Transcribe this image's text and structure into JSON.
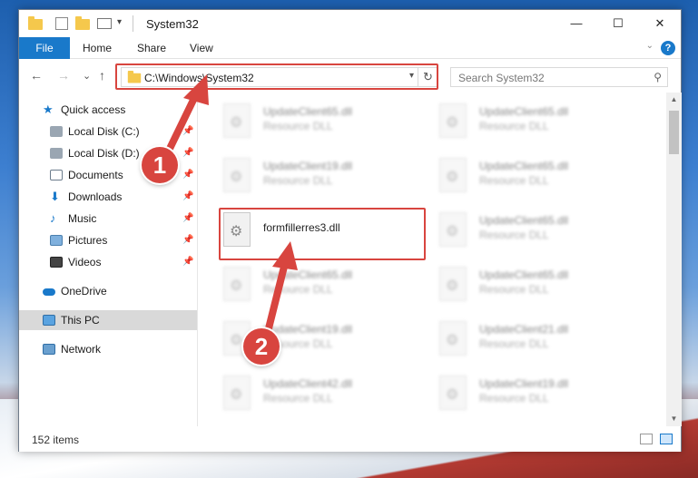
{
  "window": {
    "title": "System32",
    "tabs": [
      "File",
      "Home",
      "Share",
      "View"
    ],
    "controls": {
      "minimize": "—",
      "maximize": "☐",
      "close": "✕"
    }
  },
  "nav": {
    "back": "←",
    "forward": "→",
    "recent": "⌄",
    "up": "↑",
    "address": "C:\\Windows\\System32",
    "refresh": "↻",
    "search_placeholder": "Search System32"
  },
  "sidebar": {
    "items": [
      {
        "label": "Quick access",
        "icon": "star-icon",
        "pinned": false
      },
      {
        "label": "Local Disk (C:)",
        "icon": "drive-icon",
        "pinned": true
      },
      {
        "label": "Local Disk (D:)",
        "icon": "drive-icon",
        "pinned": true
      },
      {
        "label": "Documents",
        "icon": "documents-icon",
        "pinned": true
      },
      {
        "label": "Downloads",
        "icon": "downloads-icon",
        "pinned": true
      },
      {
        "label": "Music",
        "icon": "music-icon",
        "pinned": true
      },
      {
        "label": "Pictures",
        "icon": "pictures-icon",
        "pinned": true
      },
      {
        "label": "Videos",
        "icon": "videos-icon",
        "pinned": true
      },
      {
        "label": "OneDrive",
        "icon": "onedrive-icon",
        "pinned": false
      },
      {
        "label": "This PC",
        "icon": "this-pc-icon",
        "pinned": false,
        "selected": true
      },
      {
        "label": "Network",
        "icon": "network-icon",
        "pinned": false
      }
    ]
  },
  "files": [
    {
      "name": "UpdateClient65.dll",
      "type": "Resource DLL"
    },
    {
      "name": "UpdateClient65.dll",
      "type": "Resource DLL"
    },
    {
      "name": "UpdateClient19.dll",
      "type": "Resource DLL"
    },
    {
      "name": "UpdateClient65.dll",
      "type": "Resource DLL"
    },
    {
      "name": "formfillerres3.dll",
      "type": ""
    },
    {
      "name": "UpdateClient65.dll",
      "type": "Resource DLL"
    },
    {
      "name": "UpdateClient65.dll",
      "type": "Resource DLL"
    },
    {
      "name": "UpdateClient65.dll",
      "type": "Resource DLL"
    },
    {
      "name": "UpdateClient19.dll",
      "type": "Resource DLL"
    },
    {
      "name": "UpdateClient21.dll",
      "type": "Resource DLL"
    },
    {
      "name": "UpdateClient42.dll",
      "type": "Resource DLL"
    },
    {
      "name": "UpdateClient19.dll",
      "type": "Resource DLL"
    }
  ],
  "status": {
    "items": "152 items"
  },
  "annotations": {
    "step1": "1",
    "step2": "2"
  },
  "colors": {
    "accent": "#1979ca",
    "highlight": "#d8453f",
    "selected_nav": "#d9d9d9"
  }
}
